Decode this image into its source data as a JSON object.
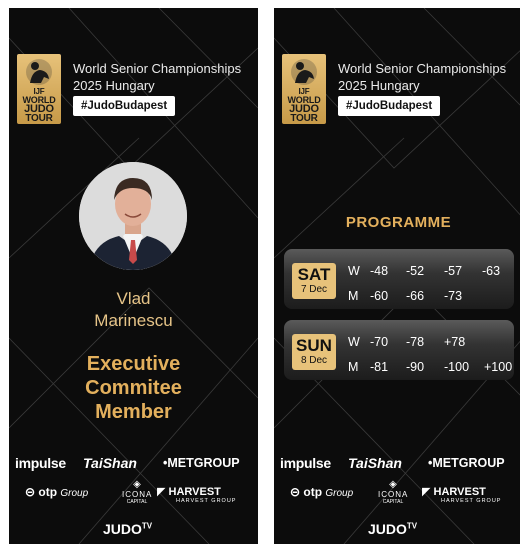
{
  "event": {
    "logo_text": [
      "IJF",
      "WORLD",
      "JUDO",
      "TOUR"
    ],
    "title_line1": "World Senior Championships",
    "title_line2": "2025 Hungary",
    "hashtag": "#JudoBudapest"
  },
  "person": {
    "first_name": "Vlad",
    "last_name": "Marinescu",
    "role_line1": "Executive",
    "role_line2": "Commitee",
    "role_line3": "Member"
  },
  "programme": {
    "title": "PROGRAMME",
    "days": [
      {
        "day": "SAT",
        "date": "7 Dec",
        "rows": [
          {
            "gender": "W",
            "classes": [
              "-48",
              "-52",
              "-57",
              "-63"
            ]
          },
          {
            "gender": "M",
            "classes": [
              "-60",
              "-66",
              "-73"
            ]
          }
        ]
      },
      {
        "day": "SUN",
        "date": "8 Dec",
        "rows": [
          {
            "gender": "W",
            "classes": [
              "-70",
              "-78",
              "+78"
            ]
          },
          {
            "gender": "M",
            "classes": [
              "-81",
              "-90",
              "-100",
              "+100"
            ]
          }
        ]
      }
    ]
  },
  "sponsors": {
    "impulse": "impulse",
    "taishan": "TaiShan",
    "met": "METGROUP",
    "otp": "otp",
    "otp_group": "Group",
    "icona": "ICONA",
    "icona_sub": "CAPITAL",
    "harvest": "HARVEST",
    "harvest_sub": "HARVEST GROUP",
    "judotv": "JUDO",
    "judotv_sup": "TV"
  },
  "colors": {
    "gold": "#e3b05d",
    "gold_light": "#e7c27a",
    "card_bg": "#0c0c0c"
  }
}
